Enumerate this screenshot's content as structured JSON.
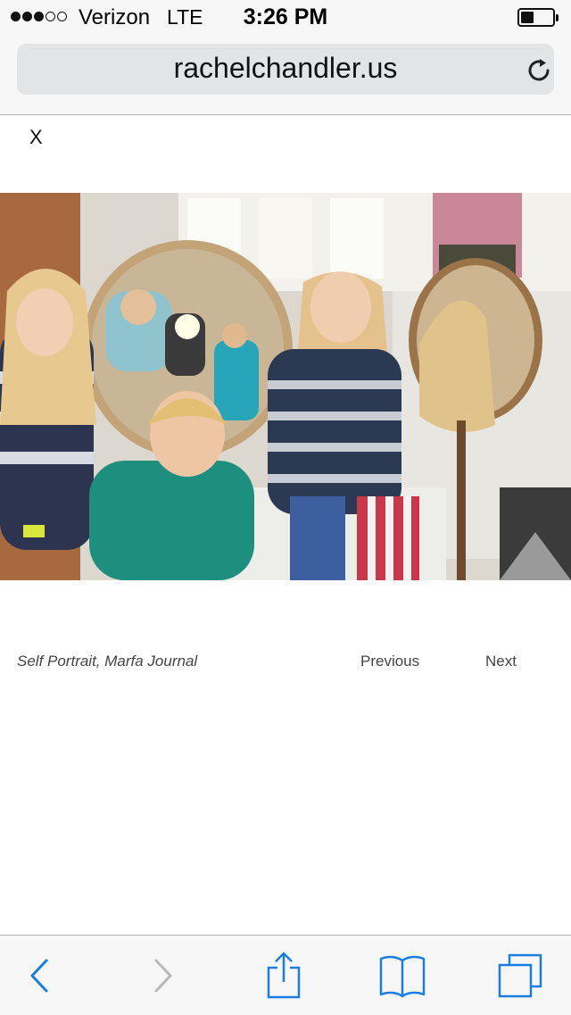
{
  "status_bar": {
    "signal_bars_filled": 3,
    "signal_bars_total": 5,
    "carrier": "Verizon",
    "network": "LTE",
    "time": "3:26 PM",
    "battery_level_percent": 40
  },
  "address_bar": {
    "url": "rachelchandler.us",
    "reload_icon": "reload-icon"
  },
  "page": {
    "close_label": "X",
    "photo_icon": "photo",
    "caption": "Self Portrait, Marfa Journal",
    "previous_label": "Previous",
    "next_label": "Next"
  },
  "toolbar": {
    "items": [
      {
        "icon": "back-chevron-icon",
        "enabled": true
      },
      {
        "icon": "forward-chevron-icon",
        "enabled": false
      },
      {
        "icon": "share-icon",
        "enabled": true
      },
      {
        "icon": "bookmarks-icon",
        "enabled": true
      },
      {
        "icon": "tabs-icon",
        "enabled": true
      }
    ]
  },
  "colors": {
    "accent": "#1a7ee0",
    "disabled": "#b8b8b8",
    "bar_background": "#f7f7f7"
  }
}
